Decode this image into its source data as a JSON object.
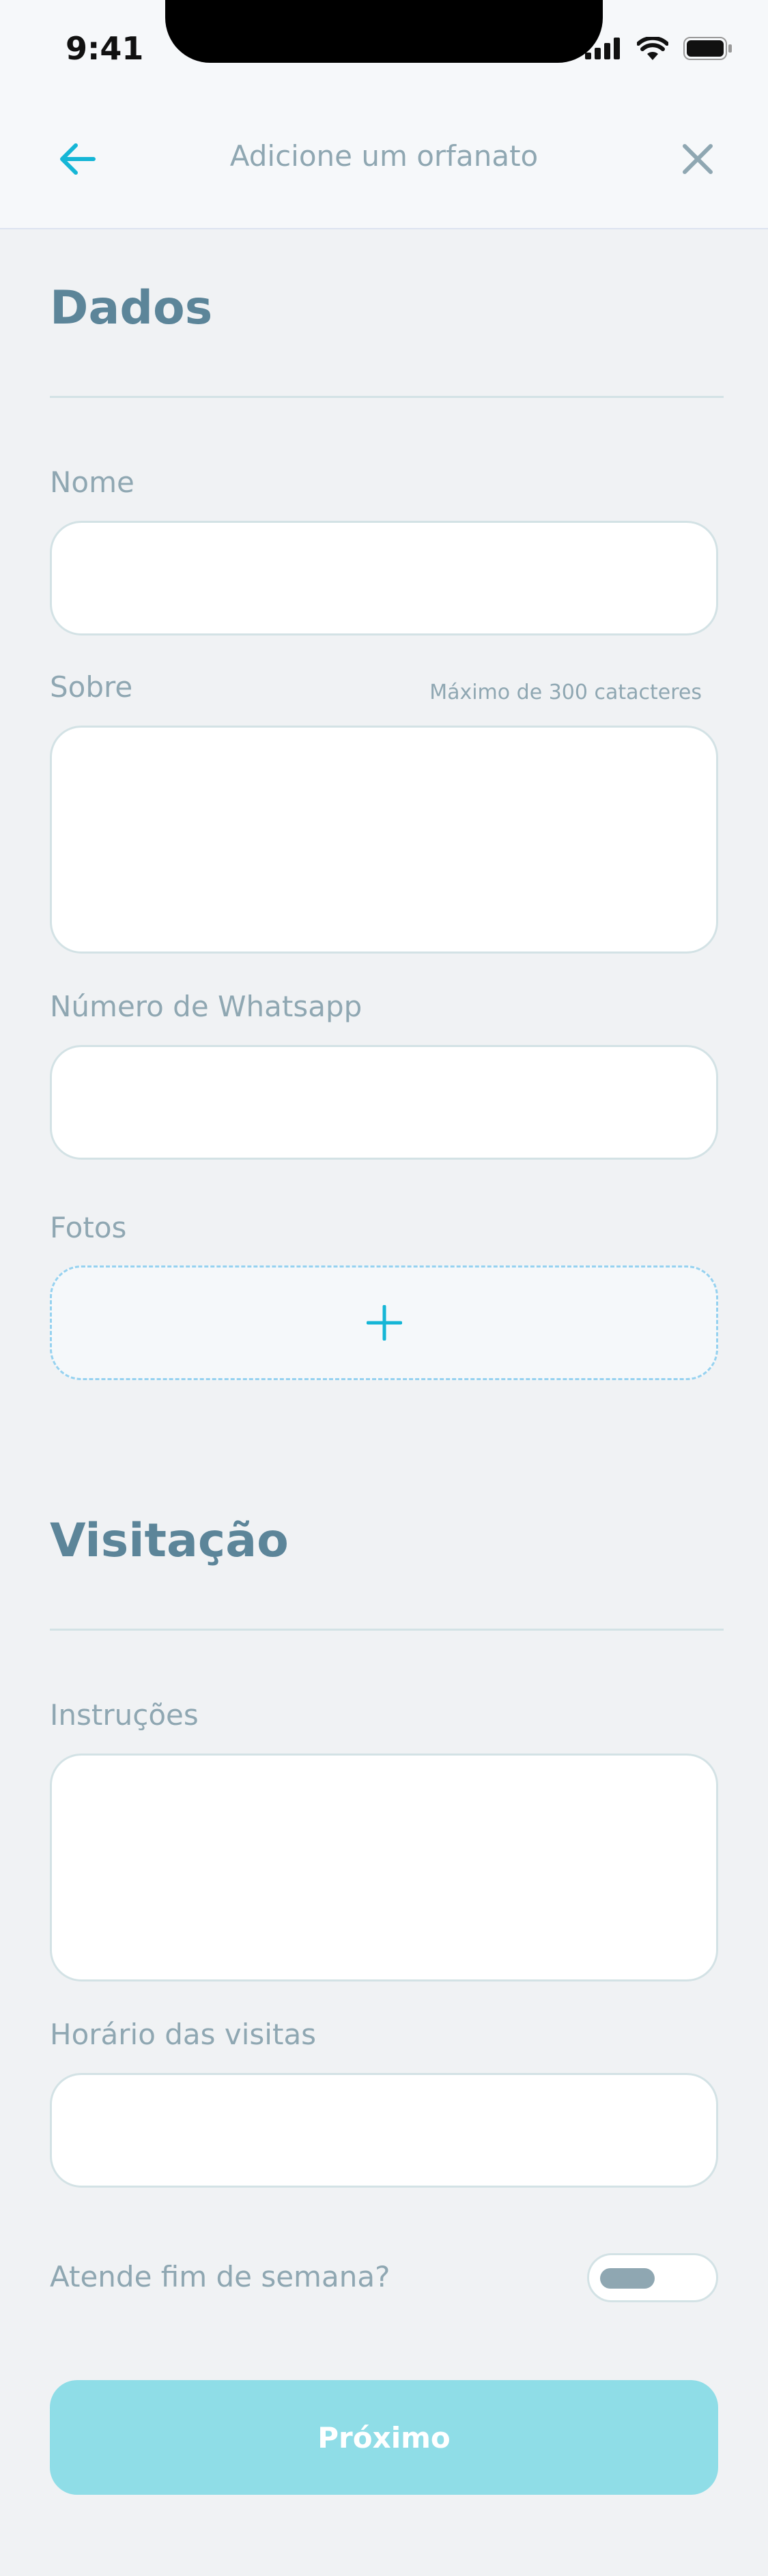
{
  "status_bar": {
    "time": "9:41"
  },
  "header": {
    "title": "Adicione um orfanato"
  },
  "dados": {
    "title": "Dados",
    "nome": {
      "label": "Nome",
      "value": ""
    },
    "sobre": {
      "label": "Sobre",
      "hint": "Máximo de 300 catacteres",
      "value": ""
    },
    "whatsapp": {
      "label": "Número de Whatsapp",
      "value": ""
    },
    "fotos": {
      "label": "Fotos"
    }
  },
  "visitacao": {
    "title": "Visitação",
    "instrucoes": {
      "label": "Instruções",
      "value": ""
    },
    "horario": {
      "label": "Horário das visitas",
      "value": ""
    },
    "fim_de_semana": {
      "label": "Atende fim de semana?",
      "enabled": false
    }
  },
  "next_button": {
    "label": "Próximo"
  },
  "colors": {
    "accent": "#15b6d6",
    "title": "#5c8599",
    "label": "#8fa7b2",
    "button": "#8fdde7",
    "border": "#d3e2e5"
  }
}
